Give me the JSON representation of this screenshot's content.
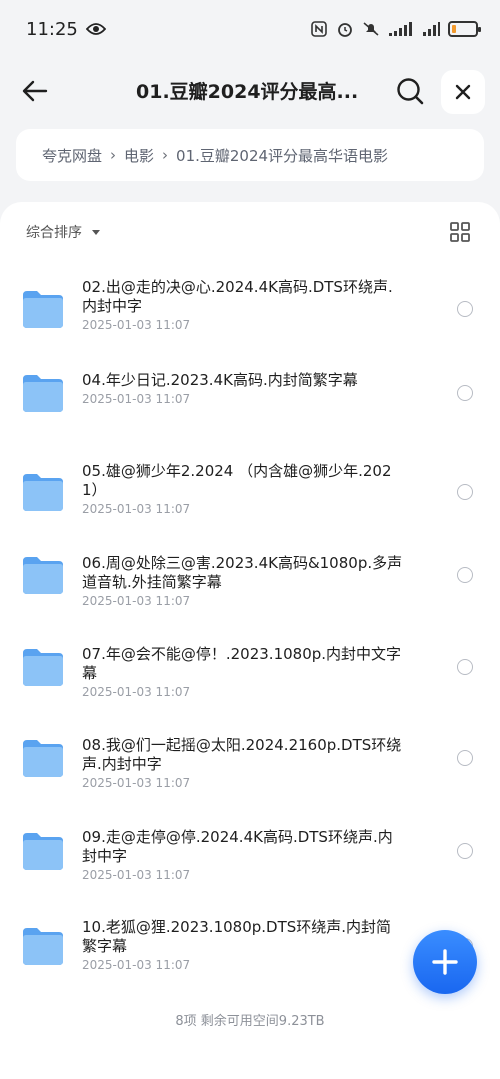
{
  "status_bar": {
    "time": "11:25",
    "battery_level": 0.15
  },
  "header": {
    "title": "01.豆瓣2024评分最高..."
  },
  "breadcrumb": {
    "items": [
      "夸克网盘",
      "电影",
      "01.豆瓣2024评分最高华语电影"
    ]
  },
  "toolbar": {
    "sort_label": "综合排序"
  },
  "files": [
    {
      "name": "02.出@走的决@心.2024.4K高码.DTS环绕声.内封中字",
      "date": "2025-01-03 11:07"
    },
    {
      "name": "04.年少日记.2023.4K高码.内封简繁字幕",
      "date": "2025-01-03 11:07"
    },
    {
      "name": "05.雄@狮少年2.2024 （内含雄@狮少年.2021）",
      "date": "2025-01-03 11:07"
    },
    {
      "name": "06.周@处除三@害.2023.4K高码&1080p.多声道音轨.外挂简繁字幕",
      "date": "2025-01-03 11:07"
    },
    {
      "name": "07.年@会不能@停！.2023.1080p.内封中文字幕",
      "date": "2025-01-03 11:07"
    },
    {
      "name": "08.我@们一起摇@太阳.2024.2160p.DTS环绕声.内封中字",
      "date": "2025-01-03 11:07"
    },
    {
      "name": "09.走@走停@停.2024.4K高码.DTS环绕声.内封中字",
      "date": "2025-01-03 11:07"
    },
    {
      "name": "10.老狐@狸.2023.1080p.DTS环绕声.内封简繁字幕",
      "date": "2025-01-03 11:07"
    }
  ],
  "footer": {
    "summary": "8项 剩余可用空间9.23TB"
  },
  "colors": {
    "accent": "#1967f0",
    "folder": "#7fb8f5",
    "battery": "#f29a2e"
  }
}
